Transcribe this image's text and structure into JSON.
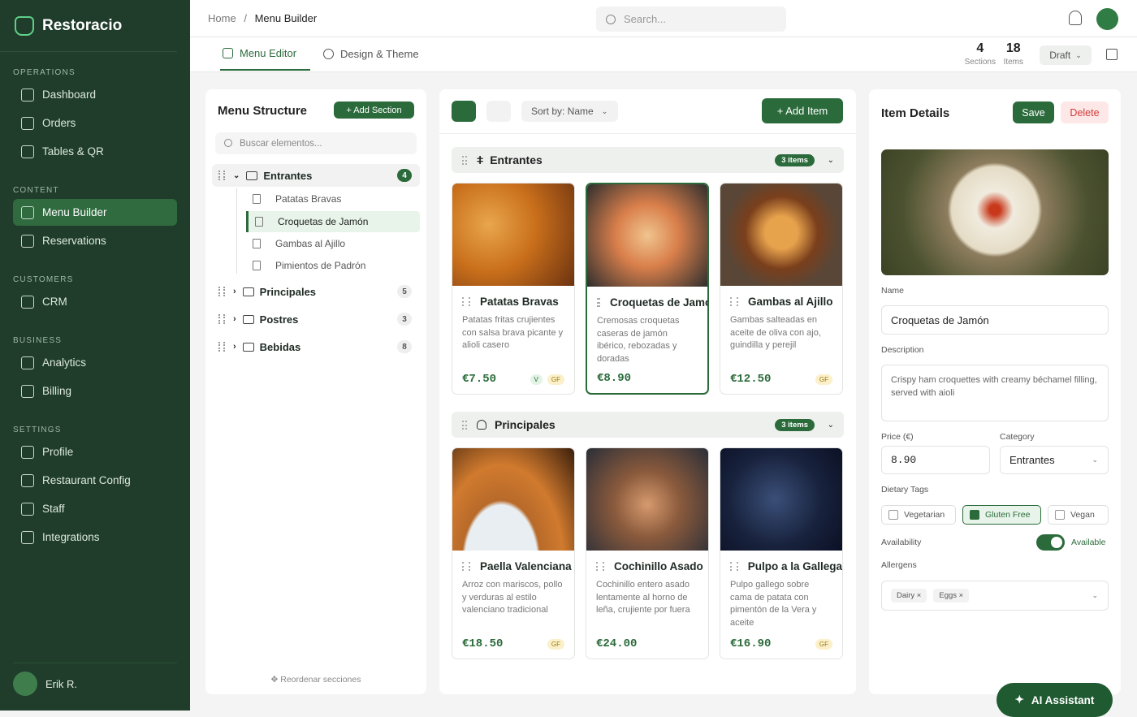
{
  "brand": {
    "name": "Restoracio"
  },
  "sidebar": {
    "groups": [
      {
        "label": "OPERATIONS",
        "items": [
          "Dashboard",
          "Orders",
          "Tables & QR"
        ]
      },
      {
        "label": "CONTENT",
        "items": [
          "Menu Builder",
          "Reservations"
        ]
      },
      {
        "label": "CUSTOMERS",
        "items": [
          "CRM"
        ]
      },
      {
        "label": "BUSINESS",
        "items": [
          "Analytics",
          "Billing"
        ]
      },
      {
        "label": "SETTINGS",
        "items": [
          "Profile",
          "Restaurant Config",
          "Staff",
          "Integrations"
        ]
      }
    ],
    "user": "Erik R."
  },
  "topbar": {
    "home": "Home",
    "sep": "/",
    "current": "Menu Builder",
    "search_placeholder": "Search..."
  },
  "subbar": {
    "tabs": [
      "Menu Editor",
      "Design & Theme"
    ],
    "sections_count": "4",
    "sections_label": "Sections",
    "items_count": "18",
    "items_label": "Items",
    "status": "Draft"
  },
  "structure": {
    "title": "Menu Structure",
    "add_section": "+ Add Section",
    "search_placeholder": "Buscar elementos...",
    "sections": [
      {
        "name": "Entrantes",
        "count": "4"
      },
      {
        "name": "Principales",
        "count": "5"
      },
      {
        "name": "Postres",
        "count": "3"
      },
      {
        "name": "Bebidas",
        "count": "8"
      }
    ],
    "children": [
      "Patatas Bravas",
      "Croquetas de Jamón",
      "Gambas al Ajillo",
      "Pimientos de Padrón"
    ],
    "reorder": "Reordenar secciones"
  },
  "editor": {
    "sort_label": "Sort by: Name",
    "add_item": "+ Add Item",
    "sections": [
      {
        "name": "Entrantes",
        "count": "3 items"
      },
      {
        "name": "Principales",
        "count": "3 items"
      }
    ],
    "items": [
      {
        "name": "Patatas Bravas",
        "desc": "Patatas fritas crujientes con salsa brava picante y alioli casero",
        "price": "€7.50",
        "tags": [
          "V",
          "GF"
        ]
      },
      {
        "name": "Croquetas de Jamón",
        "desc": "Cremosas croquetas caseras de jamón ibérico, rebozadas y doradas",
        "price": "€8.90",
        "tags": []
      },
      {
        "name": "Gambas al Ajillo",
        "desc": "Gambas salteadas en aceite de oliva con ajo, guindilla y perejil",
        "price": "€12.50",
        "tags": [
          "GF"
        ]
      },
      {
        "name": "Paella Valenciana",
        "desc": "Arroz con mariscos, pollo y verduras al estilo valenciano tradicional",
        "price": "€18.50",
        "tags": [
          "GF"
        ]
      },
      {
        "name": "Cochinillo Asado",
        "desc": "Cochinillo entero asado lentamente al horno de leña, crujiente por fuera",
        "price": "€24.00",
        "tags": []
      },
      {
        "name": "Pulpo a la Gallega",
        "desc": "Pulpo gallego sobre cama de patata con pimentón de la Vera y aceite",
        "price": "€16.90",
        "tags": [
          "GF"
        ]
      }
    ]
  },
  "details": {
    "title": "Item Details",
    "save": "Save",
    "delete": "Delete",
    "name_label": "Name",
    "name_value": "Croquetas de Jamón",
    "desc_label": "Description",
    "desc_value": "Crispy ham croquettes with creamy béchamel filling, served with aioli",
    "price_label": "Price (€)",
    "price_value": "8.90",
    "category_label": "Category",
    "category_value": "Entrantes",
    "dietary_label": "Dietary Tags",
    "dietary": [
      "Vegetarian",
      "Gluten Free",
      "Vegan"
    ],
    "availability_label": "Availability",
    "availability_value": "Available",
    "allergens_label": "Allergens",
    "allergens": [
      "Dairy ×",
      "Eggs ×"
    ]
  },
  "assistant": "AI Assistant"
}
